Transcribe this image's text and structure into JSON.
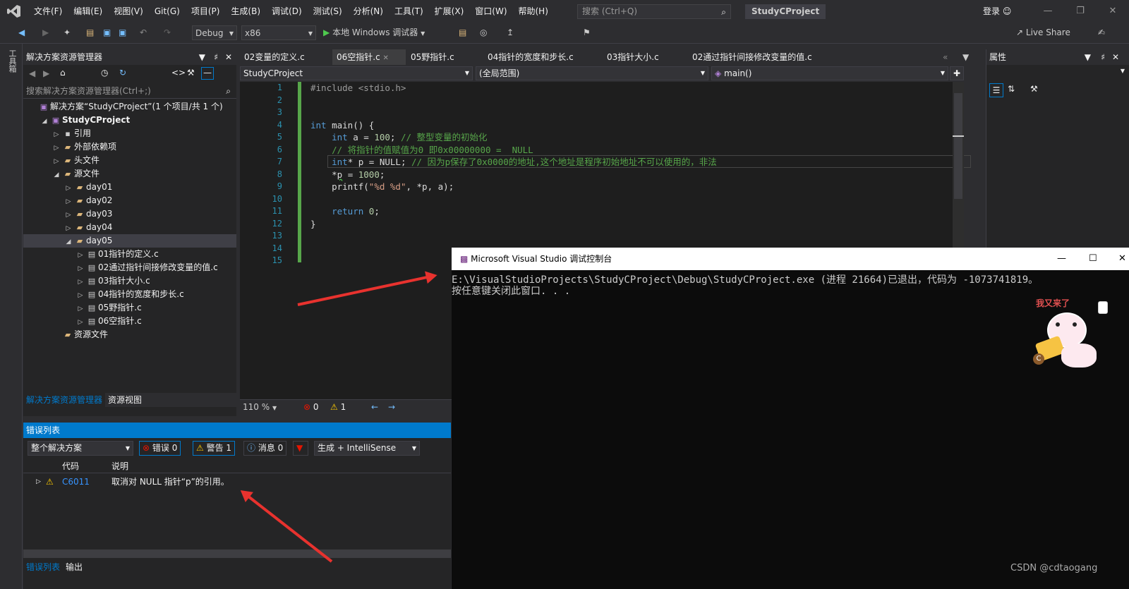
{
  "menu": [
    "文件(F)",
    "编辑(E)",
    "视图(V)",
    "Git(G)",
    "项目(P)",
    "生成(B)",
    "调试(D)",
    "测试(S)",
    "分析(N)",
    "工具(T)",
    "扩展(X)",
    "窗口(W)",
    "帮助(H)"
  ],
  "search_placeholder": "搜索 (Ctrl+Q)",
  "project_title": "StudyCProject",
  "login": "登录",
  "toolbar": {
    "config": "Debug",
    "platform": "x86",
    "run": "本地 Windows 调试器",
    "live_share": "Live Share"
  },
  "left_rail_label": "工具箱",
  "solution_explorer": {
    "title": "解决方案资源管理器",
    "search_placeholder": "搜索解决方案资源管理器(Ctrl+;)",
    "tree": [
      {
        "label": "解决方案“StudyCProject”(1 个项目/共 1 个)",
        "level": 0
      },
      {
        "label": "StudyCProject",
        "level": 1
      },
      {
        "label": "引用",
        "level": 2
      },
      {
        "label": "外部依赖项",
        "level": 2
      },
      {
        "label": "头文件",
        "level": 2
      },
      {
        "label": "源文件",
        "level": 2
      },
      {
        "label": "day01",
        "level": 3
      },
      {
        "label": "day02",
        "level": 3
      },
      {
        "label": "day03",
        "level": 3
      },
      {
        "label": "day04",
        "level": 3
      },
      {
        "label": "day05",
        "level": 3
      },
      {
        "label": "01指针的定义.c",
        "level": 4
      },
      {
        "label": "02通过指针间接修改变量的值.c",
        "level": 4
      },
      {
        "label": "03指针大小.c",
        "level": 4
      },
      {
        "label": "04指针的宽度和步长.c",
        "level": 4
      },
      {
        "label": "05野指针.c",
        "level": 4
      },
      {
        "label": "06空指针.c",
        "level": 4
      },
      {
        "label": "资源文件",
        "level": 2
      }
    ],
    "bottom_tabs": [
      "解决方案资源管理器",
      "资源视图"
    ]
  },
  "editor": {
    "tabs": [
      "02变量的定义.c",
      "06空指针.c",
      "05野指针.c",
      "04指针的宽度和步长.c",
      "03指针大小.c",
      "02通过指针间接修改变量的值.c"
    ],
    "nav_project": "StudyCProject",
    "nav_scope": "(全局范围)",
    "nav_func": "main()",
    "line_numbers": [
      "1",
      "2",
      "3",
      "4",
      "5",
      "6",
      "7",
      "8",
      "9",
      "10",
      "11",
      "12",
      "13",
      "14",
      "15"
    ],
    "zoom": "110 %",
    "errors": "0",
    "warnings": "1"
  },
  "properties_title": "属性",
  "error_list": {
    "title": "错误列表",
    "scope": "整个解决方案",
    "errors_btn": "错误 0",
    "warnings_btn": "警告 1",
    "messages_btn": "消息 0",
    "build_filter": "生成 + IntelliSense",
    "col_code": "代码",
    "col_desc": "说明",
    "row_code": "C6011",
    "row_desc": "取消对 NULL 指针“p”的引用。",
    "bottom_tabs": [
      "错误列表",
      "输出"
    ]
  },
  "console": {
    "title": "Microsoft Visual Studio 调试控制台",
    "line1": "E:\\VisualStudioProjects\\StudyCProject\\Debug\\StudyCProject.exe (进程 21664)已退出，代码为 -1073741819。",
    "line2": "按任意键关闭此窗口. . .",
    "sticker_text": "我又来了",
    "watermark": "CSDN @cdtaogang"
  }
}
